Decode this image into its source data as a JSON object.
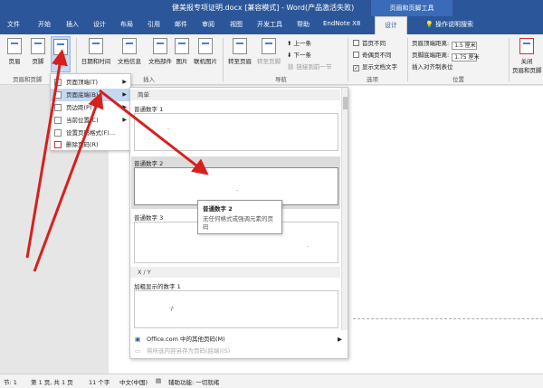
{
  "window": {
    "title": "健美报专项证明.docx [兼容模式] - Word(产品激活失败)",
    "context_group": "页眉和页脚工具"
  },
  "tabs": [
    "文件",
    "开始",
    "插入",
    "设计",
    "布局",
    "引用",
    "邮件",
    "审阅",
    "视图",
    "开发工具",
    "帮助",
    "EndNote X8",
    "设计"
  ],
  "tell_me": "操作说明搜索",
  "ribbon": {
    "header_label": "页眉",
    "footer_label": "页脚",
    "pagenum_label": "页码",
    "datetime_label": "日期和时间",
    "docinfo_label": "文档信息",
    "docparts_label": "文档部件",
    "picture_label": "图片",
    "online_picture_label": "联机图片",
    "goto_header_label": "转至页眉",
    "goto_footer_label": "转至页脚",
    "prev_label": "上一条",
    "next_label": "下一条",
    "link_prev_label": "链接到前一节",
    "diff_first_label": "首页不同",
    "diff_oddeven_label": "奇偶页不同",
    "show_text_label": "显示文档文字",
    "header_dist_label": "页眉顶端距离:",
    "header_dist_value": "1.5 厘米",
    "footer_dist_label": "页脚底端距离:",
    "footer_dist_value": "1.75 厘米",
    "align_tab_label": "插入对齐制表位",
    "close_label": "关闭",
    "close_label2": "页眉和页脚",
    "group_hf": "页眉和页脚",
    "group_insert": "插入",
    "group_nav": "导航",
    "group_options": "选项",
    "group_position": "位置"
  },
  "pagenum_menu": {
    "items": [
      {
        "label": "页面顶端(T)",
        "state": "normal"
      },
      {
        "label": "页面底端(B)",
        "state": "highlighted"
      },
      {
        "label": "页边距(P)",
        "state": "normal"
      },
      {
        "label": "当前位置(C)",
        "state": "normal"
      },
      {
        "label": "设置页码格式(F)...",
        "state": "normal"
      },
      {
        "label": "删除页码(R)",
        "state": "normal"
      }
    ]
  },
  "flyout": {
    "category1": "简单",
    "item1": "普通数字 1",
    "item2": "普通数字 2",
    "item3": "普通数字 3",
    "category2": "X / Y",
    "item4": "加粗显示的数字 1",
    "footer1": "Office.com 中的其他页码(M)",
    "footer2": "将所选内容另存为页码(底端)(S)"
  },
  "tooltip": {
    "title": "普通数字 2",
    "desc": "无任何格式或强调元素的页码"
  },
  "status": {
    "section": "节: 1",
    "page": "第 1 页, 共 1 页",
    "words": "11 个字",
    "language": "中文(中国)",
    "accessibility": "辅助功能: 一切就绪"
  },
  "colors": {
    "titlebar": "#2b579a",
    "arrow": "#d6201e",
    "highlight": "#c5d8f1"
  }
}
